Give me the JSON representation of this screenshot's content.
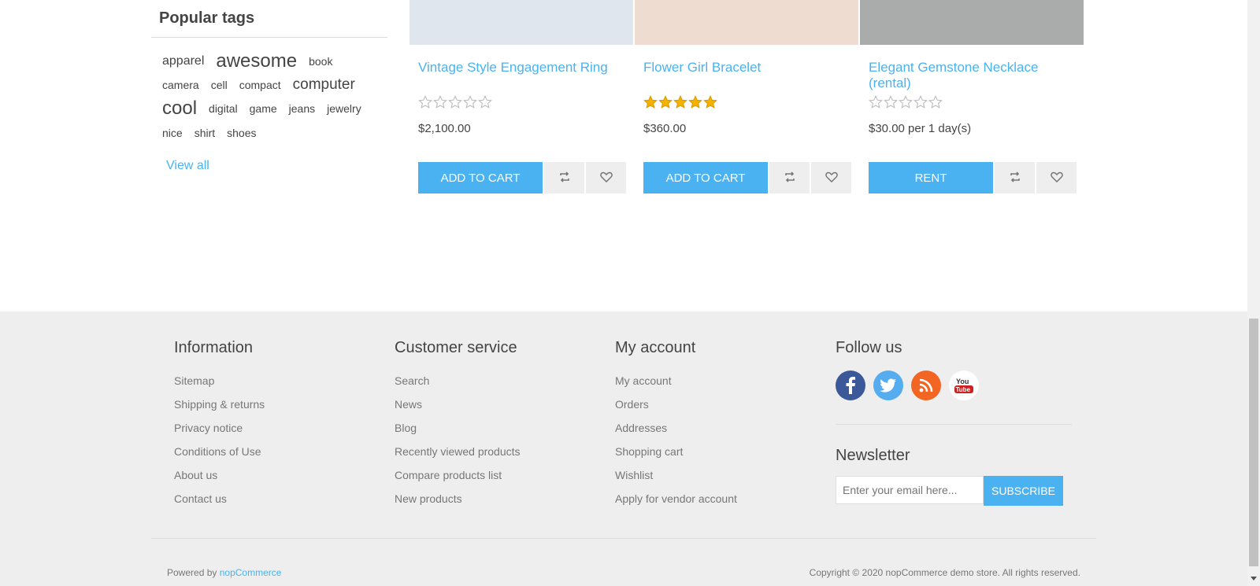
{
  "sidebar": {
    "tags_title": "Popular tags",
    "tags": [
      {
        "label": "apparel",
        "size": 16
      },
      {
        "label": "awesome",
        "size": 24
      },
      {
        "label": "book",
        "size": 14
      },
      {
        "label": "camera",
        "size": 14
      },
      {
        "label": "cell",
        "size": 14
      },
      {
        "label": "compact",
        "size": 14
      },
      {
        "label": "computer",
        "size": 19
      },
      {
        "label": "cool",
        "size": 24
      },
      {
        "label": "digital",
        "size": 14
      },
      {
        "label": "game",
        "size": 14
      },
      {
        "label": "jeans",
        "size": 14
      },
      {
        "label": "jewelry",
        "size": 14
      },
      {
        "label": "nice",
        "size": 14
      },
      {
        "label": "shirt",
        "size": 14
      },
      {
        "label": "shoes",
        "size": 14
      }
    ],
    "view_all": "View all"
  },
  "products": [
    {
      "title": "Vintage Style Engagement Ring",
      "rating": 0,
      "price": "$2,100.00",
      "button": "ADD TO CART",
      "image_color": "#dfe6ee"
    },
    {
      "title": "Flower Girl Bracelet",
      "rating": 5,
      "price": "$360.00",
      "button": "ADD TO CART",
      "image_color": "#efdcd0"
    },
    {
      "title": "Elegant Gemstone Necklace (rental)",
      "rating": 0,
      "price": "$30.00 per 1 day(s)",
      "button": "RENT",
      "image_color": "#a9acaa"
    }
  ],
  "footer": {
    "information": {
      "title": "Information",
      "links": [
        "Sitemap",
        "Shipping & returns",
        "Privacy notice",
        "Conditions of Use",
        "About us",
        "Contact us"
      ]
    },
    "customer_service": {
      "title": "Customer service",
      "links": [
        "Search",
        "News",
        "Blog",
        "Recently viewed products",
        "Compare products list",
        "New products"
      ]
    },
    "my_account": {
      "title": "My account",
      "links": [
        "My account",
        "Orders",
        "Addresses",
        "Shopping cart",
        "Wishlist",
        "Apply for vendor account"
      ]
    },
    "follow": {
      "title": "Follow us",
      "icons": [
        "facebook-icon",
        "twitter-icon",
        "rss-icon",
        "youtube-icon"
      ]
    },
    "newsletter": {
      "title": "Newsletter",
      "placeholder": "Enter your email here...",
      "button": "SUBSCRIBE"
    },
    "powered_prefix": "Powered by",
    "powered_link": "nopCommerce",
    "copyright": "Copyright © 2020 nopCommerce demo store. All rights reserved."
  },
  "colors": {
    "accent": "#4ab2f1",
    "star": "#f5b301",
    "facebook": "#3b5998",
    "twitter": "#55acee",
    "rss": "#f26522",
    "youtube_bg": "#ffffff",
    "youtube": "#cd201f"
  }
}
